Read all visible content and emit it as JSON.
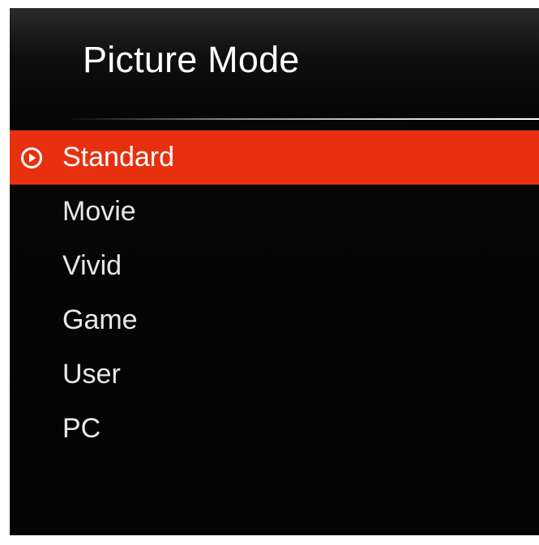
{
  "menu": {
    "title": "Picture Mode",
    "selected_index": 0,
    "items": [
      {
        "label": "Standard"
      },
      {
        "label": "Movie"
      },
      {
        "label": "Vivid"
      },
      {
        "label": "Game"
      },
      {
        "label": "User"
      },
      {
        "label": "PC"
      }
    ]
  },
  "colors": {
    "highlight": "#e8300f",
    "background": "#060606",
    "text": "#e8e8e8"
  },
  "icons": {
    "selected_marker": "play-circle-icon"
  }
}
